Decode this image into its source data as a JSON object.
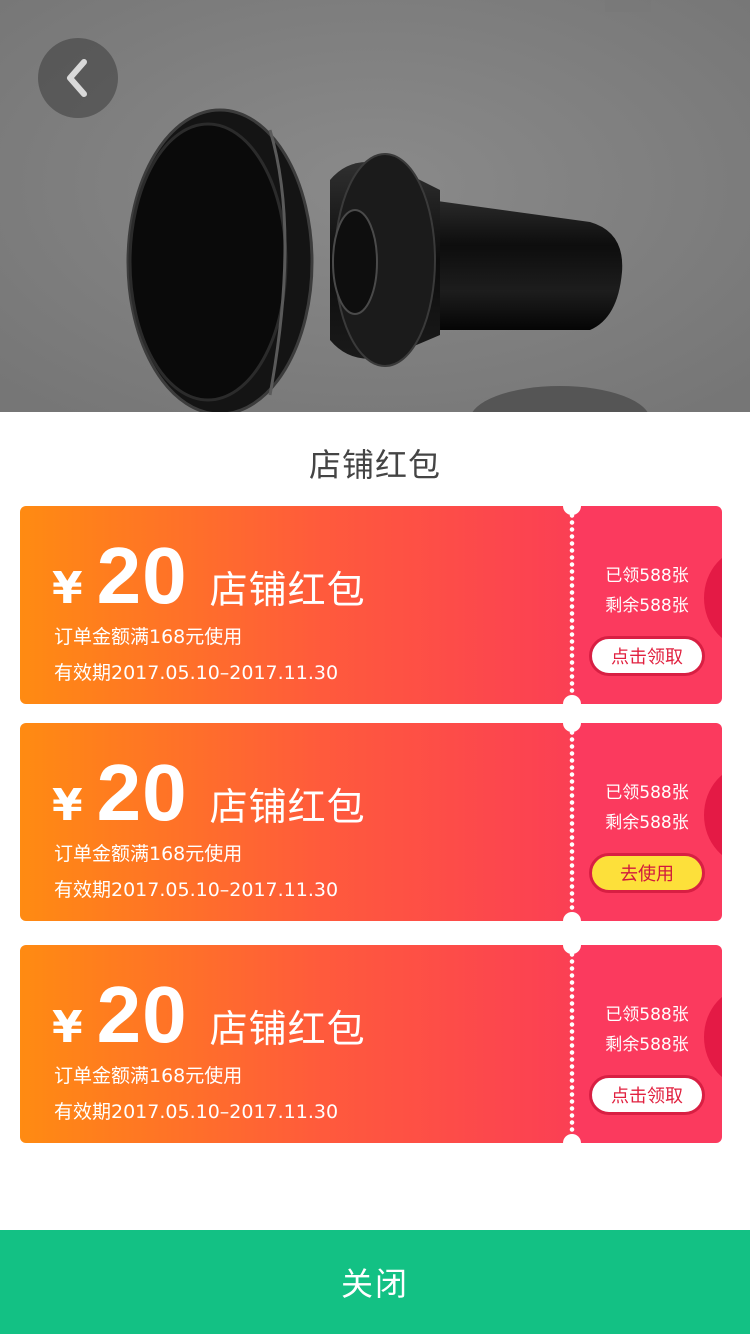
{
  "sheet": {
    "title": "店铺红包"
  },
  "coupons": [
    {
      "currency": "¥",
      "amount": "20",
      "name": "店铺红包",
      "condition": "订单金额满168元使用",
      "validity": "有效期2017.05.10–2017.11.30",
      "claimed": "已领588张",
      "remaining": "剩余588张",
      "action": "点击领取"
    },
    {
      "currency": "¥",
      "amount": "20",
      "name": "店铺红包",
      "condition": "订单金额满168元使用",
      "validity": "有效期2017.05.10–2017.11.30",
      "claimed": "已领588张",
      "remaining": "剩余588张",
      "action": "去使用"
    },
    {
      "currency": "¥",
      "amount": "20",
      "name": "店铺红包",
      "condition": "订单金额满168元使用",
      "validity": "有效期2017.05.10–2017.11.30",
      "claimed": "已领588张",
      "remaining": "剩余588张",
      "action": "点击领取"
    }
  ],
  "footer": {
    "close_label": "关闭"
  },
  "icons": {
    "back": "chevron-left-icon"
  },
  "colors": {
    "coupon_gradient_start": "#ff8b12",
    "coupon_gradient_end": "#fb3f54",
    "coupon_right": "#fb3a5e",
    "use_button": "#fde03a",
    "close_bar": "#13c184"
  }
}
